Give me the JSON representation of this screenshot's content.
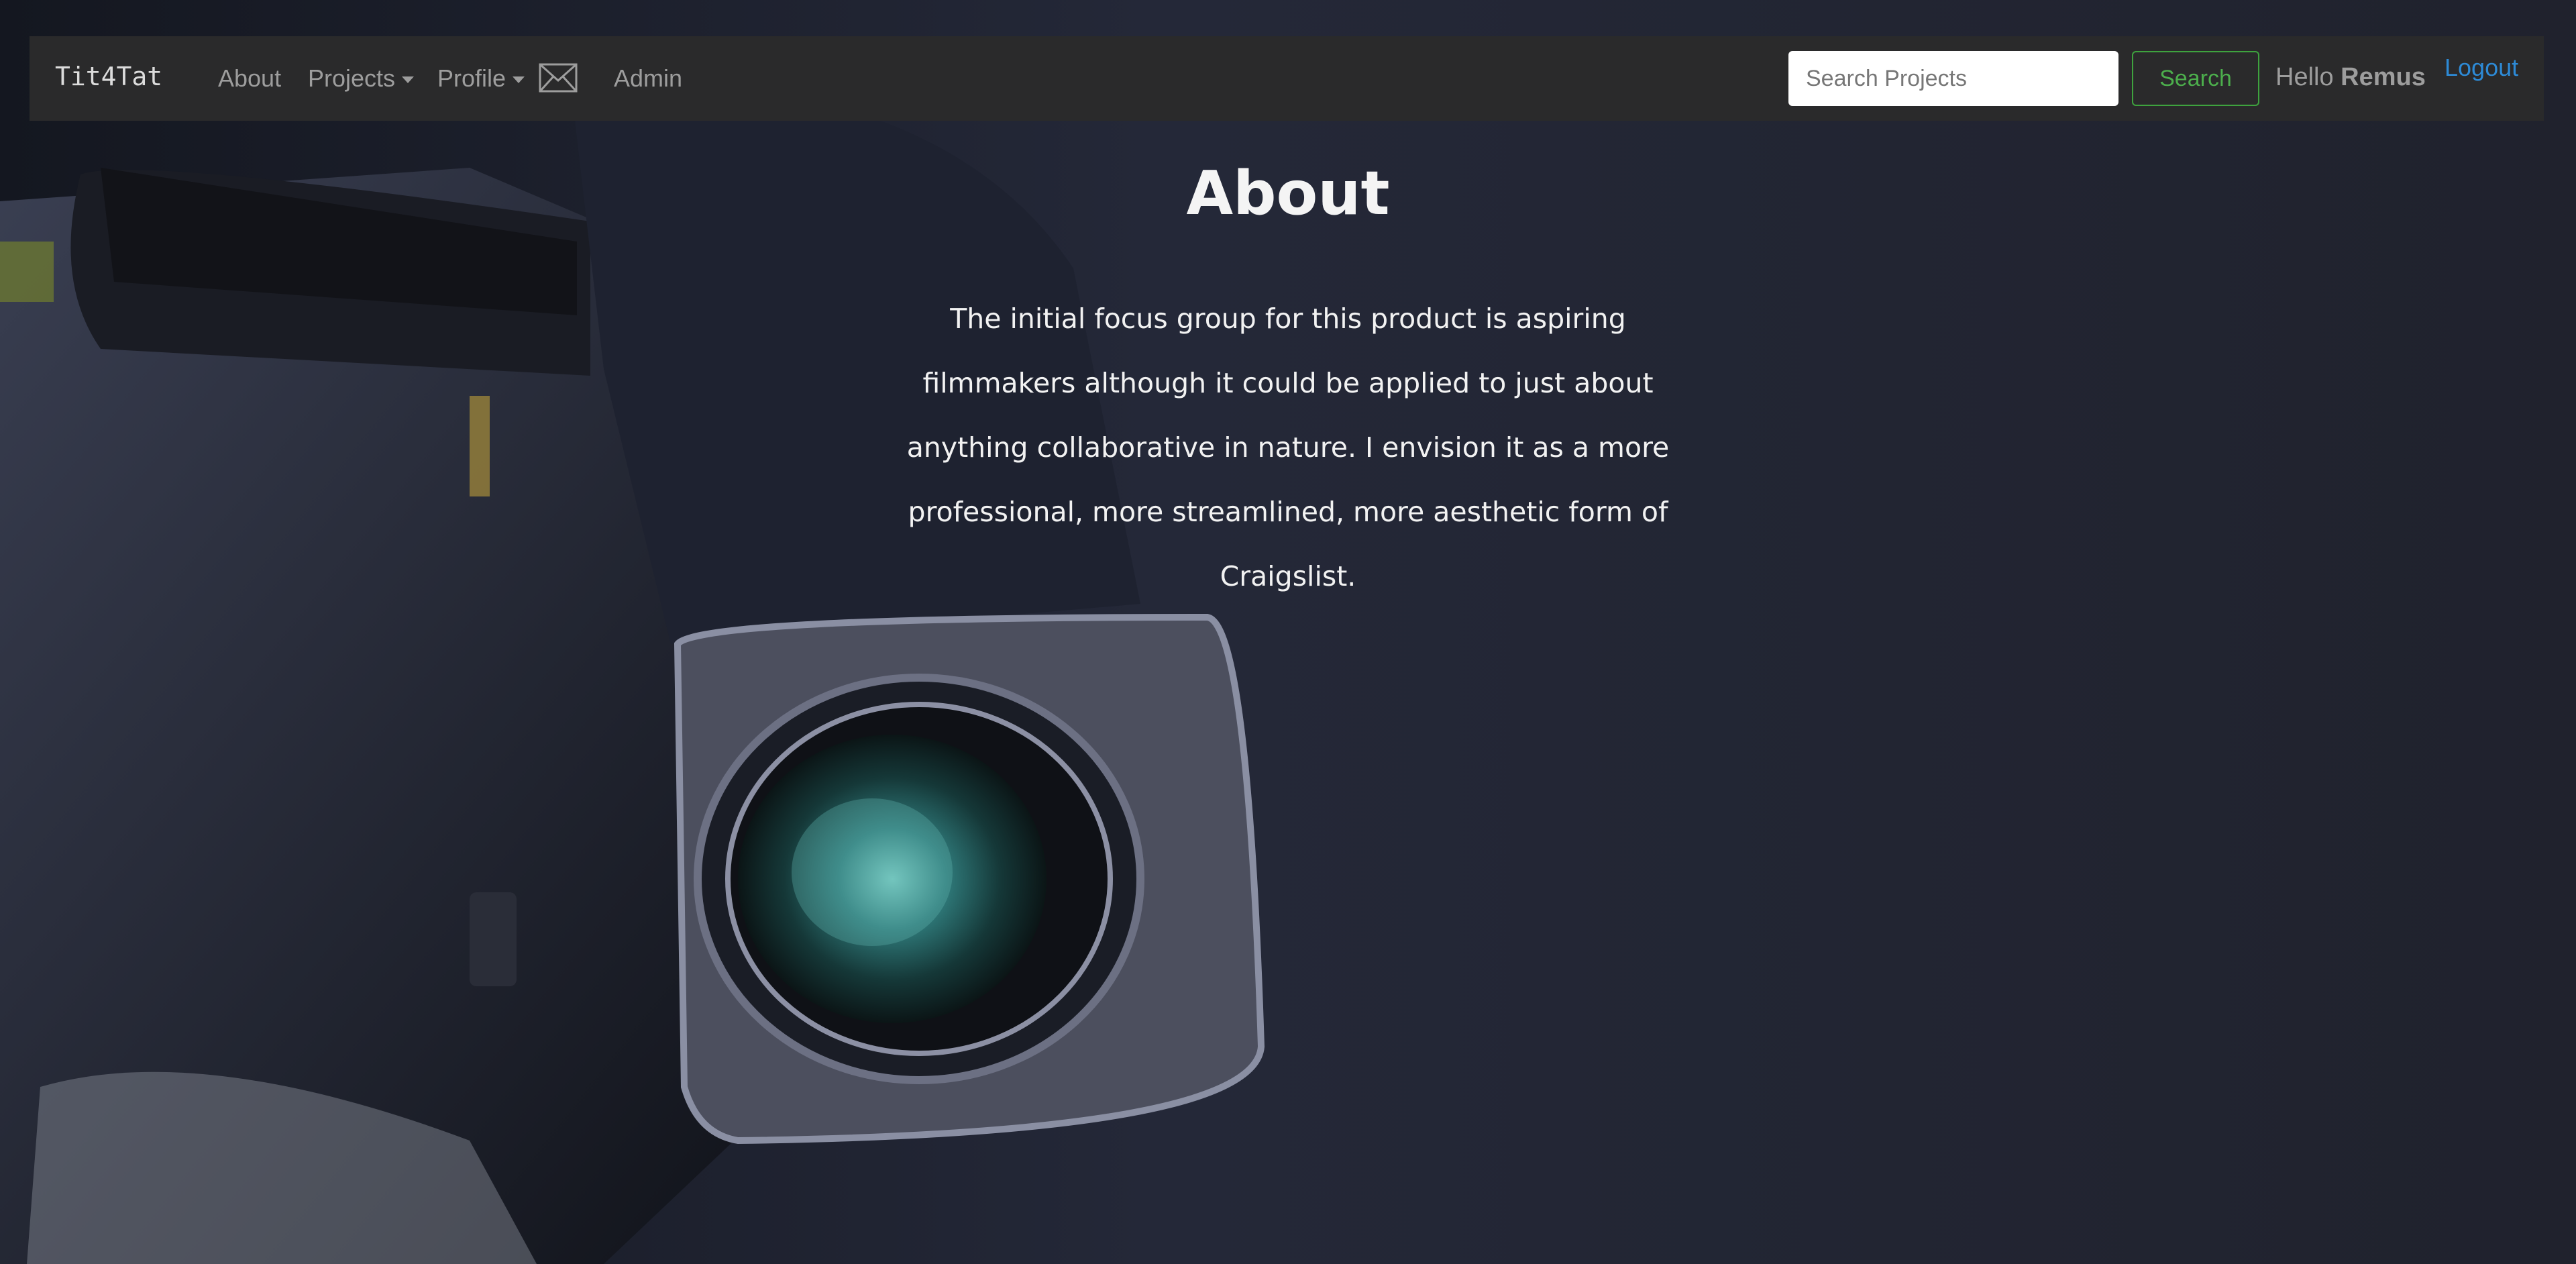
{
  "navbar": {
    "brand": "Tit4Tat",
    "links": {
      "about": "About",
      "projects": "Projects",
      "profile": "Profile",
      "admin": "Admin"
    },
    "search": {
      "placeholder": "Search Projects",
      "button_label": "Search"
    },
    "greeting_prefix": "Hello",
    "username": "Remus",
    "logout_label": "Logout"
  },
  "main": {
    "title": "About",
    "paragraph": "The initial focus group for this product is aspiring filmmakers although it could be applied to just about anything collaborative in nature. I envision it as a more professional, more streamlined, more aesthetic form of Craigslist."
  },
  "colors": {
    "navbar_bg": "#2a2a2b",
    "nav_text": "#9d9d9d",
    "search_button": "#4cae4c",
    "logout_link": "#2d8ad6",
    "page_bg": "#1c1e28"
  },
  "icons": {
    "messages": "envelope-icon",
    "dropdown": "caret-down-icon"
  },
  "background_image": "professional video camera with lens"
}
